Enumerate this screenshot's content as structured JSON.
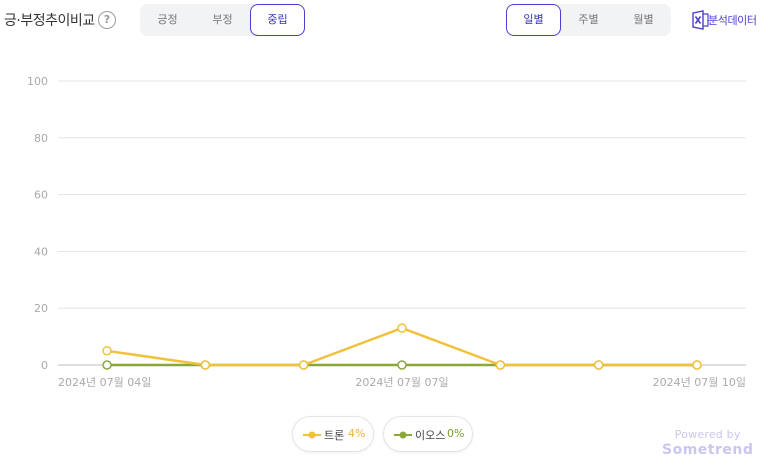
{
  "header": {
    "title": "긍·부정추이비교",
    "help_glyph": "?",
    "sentiment_tabs": [
      "긍정",
      "부정",
      "중립"
    ],
    "sentiment_active": "중립",
    "period_tabs": [
      "일별",
      "주별",
      "월별"
    ],
    "period_active": "일별",
    "export_label": "분석데이터",
    "export_icon": "excel-icon"
  },
  "chart_data": {
    "type": "line",
    "x": [
      "2024년 07월 04일",
      "2024년 07월 05일",
      "2024년 07월 06일",
      "2024년 07월 07일",
      "2024년 07월 08일",
      "2024년 07월 09일",
      "2024년 07월 10일"
    ],
    "x_tick_labels": [
      "2024년 07월 04일",
      "2024년 07월 07일",
      "2024년 07월 10일"
    ],
    "ylim": [
      0,
      100
    ],
    "yticks": [
      0,
      20,
      40,
      60,
      80,
      100
    ],
    "grid": true,
    "legend_position": "bottom-center",
    "series": [
      {
        "name": "트론",
        "percent_label": "4%",
        "color": "#f0c23b",
        "values": [
          5,
          0,
          0,
          13,
          0,
          0,
          0
        ]
      },
      {
        "name": "이오스",
        "percent_label": "0%",
        "color": "#8aa83a",
        "values": [
          0,
          0,
          0,
          0,
          0,
          0,
          0
        ]
      }
    ]
  },
  "footer": {
    "powered_by": "Powered by",
    "brand": "Sometrend"
  }
}
